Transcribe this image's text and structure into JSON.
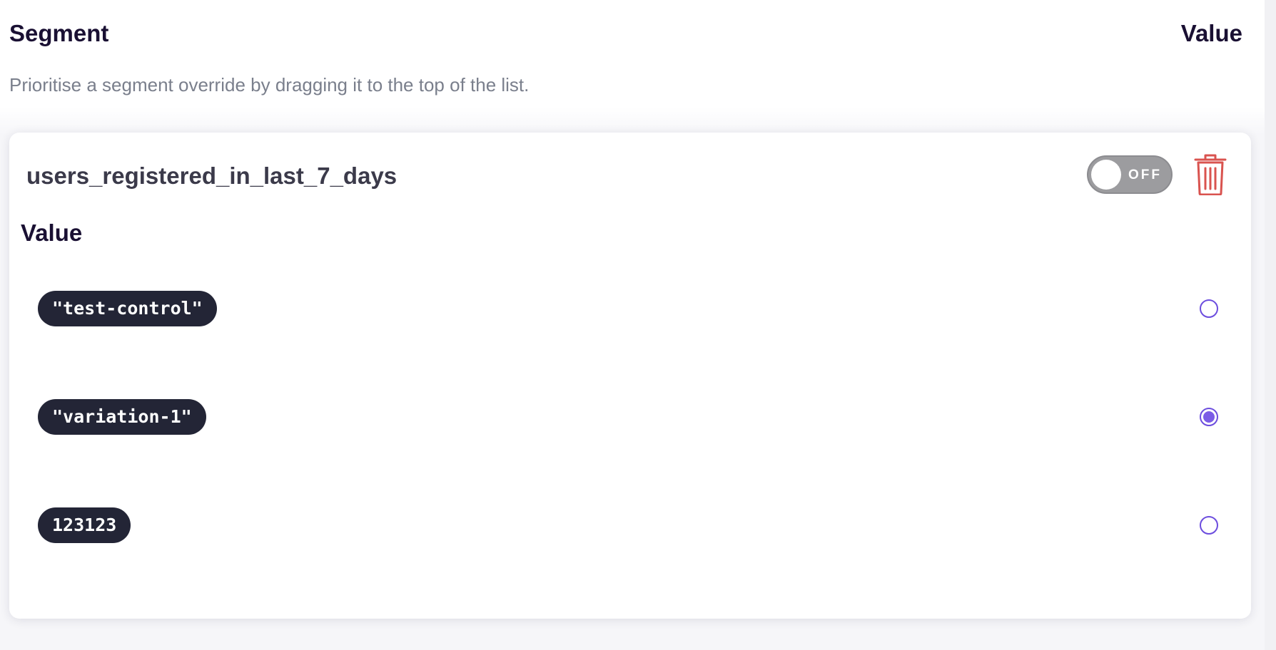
{
  "header": {
    "segment_label": "Segment",
    "value_label": "Value"
  },
  "hint": "Prioritise a segment override by dragging it to the top of the list.",
  "override": {
    "segment_name": "users_registered_in_last_7_days",
    "enabled": false,
    "toggle_label": "OFF",
    "value_heading": "Value",
    "options": [
      {
        "label": "\"test-control\"",
        "selected": false
      },
      {
        "label": "\"variation-1\"",
        "selected": true
      },
      {
        "label": "123123",
        "selected": false
      }
    ]
  },
  "colors": {
    "accent": "#7b5ce6",
    "chip_bg": "#232536",
    "delete": "#d9534f",
    "toggle_off": "#9c9c9f"
  },
  "icons": {
    "delete": "trash-icon"
  }
}
